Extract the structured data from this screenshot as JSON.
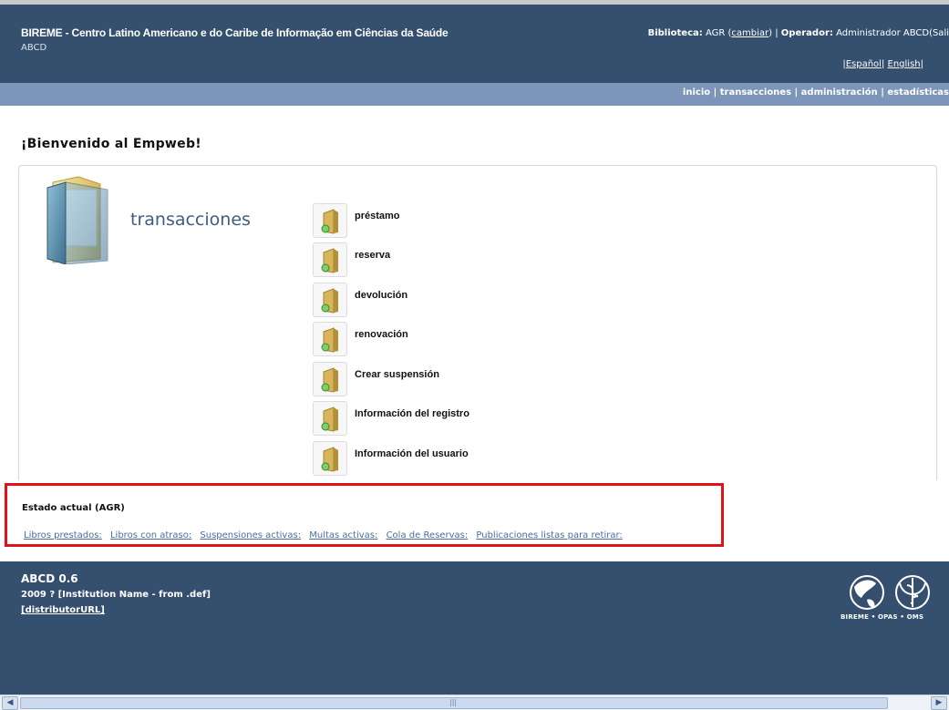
{
  "header": {
    "site_title": "BIREME - Centro Latino Americano e do Caribe de Informação em Ciências da Saúde",
    "site_subtitle": "ABCD",
    "library_label": "Biblioteca:",
    "library_value": "AGR",
    "change_link": "cambiar",
    "operator_label": "Operador:",
    "operator_value": "Administrador ABCD",
    "logout_partial": "(Sali",
    "lang_es": "Español",
    "lang_en": "English"
  },
  "nav": {
    "items": [
      "inicio",
      "transacciones",
      "administración",
      "estadísticas"
    ]
  },
  "main": {
    "welcome": "¡Bienvenido al Empweb!",
    "section_title": "transacciones",
    "menu_items": [
      "préstamo",
      "reserva",
      "devolución",
      "renovación",
      "Crear suspensión",
      "Información del registro",
      "Información del usuario"
    ]
  },
  "status": {
    "title": "Estado actual (AGR)",
    "links": [
      "Libros prestados:",
      "Libros con atraso:",
      "Suspensiones activas:",
      "Multas activas:",
      "Cola de Reservas:",
      "Publicaciones listas para retirar:"
    ]
  },
  "footer": {
    "version": "ABCD 0.6",
    "institution": "2009 ? [Institution Name - from .def]",
    "distributor": "[distributorURL]",
    "logo_text": "BIREME • OPAS • OMS"
  },
  "colors": {
    "header_bg": "#35506f",
    "nav_bg": "#7d95b8",
    "highlight_border": "#e0131b",
    "link": "#4a6d99"
  }
}
